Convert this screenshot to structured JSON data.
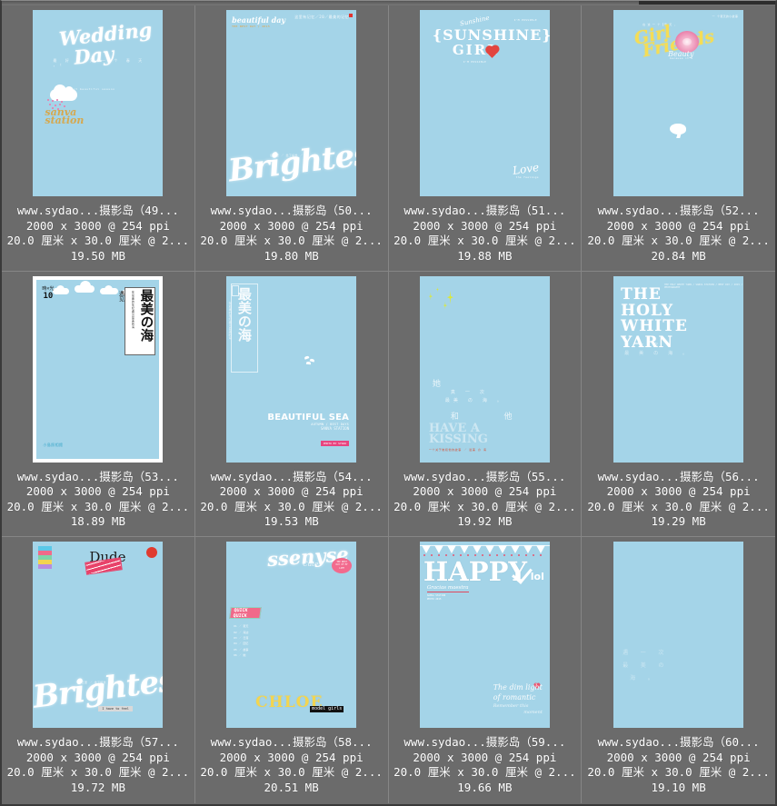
{
  "app": {
    "window_title": "Image Browser Grid",
    "background_color": "#6b6b6b",
    "thumbnail_color": "#a4d4e8",
    "grid_columns": 4,
    "grid_rows": 3
  },
  "items": [
    {
      "filename": "www.sydao...摄影岛（49...",
      "dimensions": "2000 x 3000 @ 254 ppi",
      "physical": "20.0 厘米 x 30.0 厘米 @ 2...",
      "filesize": "19.50 MB",
      "art": {
        "title": "Wedding",
        "title2": "Day",
        "subtitle": "最 好 了 又 一 个 春 天 ，！",
        "brand": "sanva",
        "brand2": "station",
        "brandline": "the most beautiful season"
      }
    },
    {
      "filename": "www.sydao...摄影岛（50...",
      "dimensions": "2000 x 3000 @ 254 ppi",
      "physical": "20.0 厘米 x 30.0 厘米 @ 2...",
      "filesize": "19.80 MB",
      "art": {
        "head": "beautiful day",
        "head_sub": "THE BEST DAY / 2015",
        "topright": "这里有记忆／20／最美的记忆",
        "main": "Brightest",
        "main_sub": "记忆里 ／ 念了好长 ／ 一 ．"
      }
    },
    {
      "filename": "www.sydao...摄影岛（51...",
      "dimensions": "2000 x 3000 @ 254 ppi",
      "physical": "20.0 厘米 x 30.0 厘米 @ 2...",
      "filesize": "19.88 MB",
      "art": {
        "script": "Sunshine",
        "brace": "{SUNSHINE}",
        "girl": "GIRL",
        "tagline": "I'M POSSIBLE",
        "love": "Love",
        "love_sub": "the feelings"
      }
    },
    {
      "filename": "www.sydao...摄影岛（52...",
      "dimensions": "2000 x 3000 @ 254 ppi",
      "physical": "20.0 厘米 x 30.0 厘米 @ 2...",
      "filesize": "20.84 MB",
      "art": {
        "title": "Girl",
        "title2": "Friends",
        "cn_top": "在  这  一  个 ┃夏 天 ，",
        "topright": "一 个夏天的小故事",
        "sig": "because it's",
        "sig2": "Beauty"
      }
    },
    {
      "filename": "www.sydao...摄影岛（53...",
      "dimensions": "2000 x 3000 @ 254 ppi",
      "physical": "20.0 厘米 x 30.0 厘米 @ 2...",
      "filesize": "18.89 MB",
      "art": {
        "title": "最美の海",
        "author": "遇见",
        "side": "在最美的年纪遇见最美的海",
        "left_label": "時×光",
        "left_num": "10",
        "foot": "小島照相館"
      }
    },
    {
      "filename": "www.sydao...摄影岛（54...",
      "dimensions": "2000 x 3000 @ 254 ppi",
      "physical": "20.0 厘米 x 30.0 厘米 @ 2...",
      "filesize": "19.53 MB",
      "art": {
        "title": "最美の海",
        "side": "在最美的年纪遇见最美的海",
        "tag": "最 美",
        "en": "BEAUTIFUL SEA",
        "en_sub": "AUTUMN / BEST DAYS",
        "en_sub2": "SANVA STATION",
        "pink": "PHOTO BY SYDAO"
      }
    },
    {
      "filename": "www.sydao...摄影岛（55...",
      "dimensions": "2000 x 3000 @ 254 ppi",
      "physical": "20.0 厘米 x 30.0 厘米 @ 2...",
      "filesize": "19.92 MB",
      "art": {
        "cn1": "她",
        "cn2": "真 一 次",
        "cn3": "最美 の 海 。",
        "cn4": "和",
        "cn5": "他",
        "en1": "HAVE A",
        "en2": "KISSING",
        "red": "一个关于她和他的故事 ／ 最美 の 海"
      }
    },
    {
      "filename": "www.sydao...摄影岛（56...",
      "dimensions": "2000 x 3000 @ 254 ppi",
      "physical": "20.0 厘米 x 30.0 厘米 @ 2...",
      "filesize": "19.29 MB",
      "art": {
        "l1": "THE",
        "l2": "HOLY",
        "l3": "WHITE",
        "l4": "YARN",
        "cn1": "遇 一 次",
        "cn2": "最 美 の 海 。",
        "side": "THE HOLY WHITE YARN / SANVA STATION / BEST DAY / 2015 / PHOTOGRAPHY"
      }
    },
    {
      "filename": "www.sydao...摄影岛（57...",
      "dimensions": "2000 x 3000 @ 254 ppi",
      "physical": "20.0 厘米 x 30.0 厘米 @ 2...",
      "filesize": "19.72 MB",
      "art": {
        "title": "Dude",
        "main": "Brightest",
        "main_sub": "记忆里 ／ 念了好长 ／ 一 ．",
        "foot": "I have to feel"
      }
    },
    {
      "filename": "www.sydao...摄影岛（58...",
      "dimensions": "2000 x 3000 @ 254 ppi",
      "physical": "20.0 厘米 x 30.0 厘米 @ 2...",
      "filesize": "20.51 MB",
      "art": {
        "title": "ssenyse",
        "sub": "Cute",
        "badge": "THE BEST DAY OF MY LIFE",
        "quick": "QUICK QUICK",
        "list": "01 ／ 夏天\n02 ／ 海边\n03 ／ 日落\n04 ／ 回忆\n05 ／ 故事\n06 ／ 她",
        "name": "CHLOE",
        "name_blk": "model girls"
      }
    },
    {
      "filename": "www.sydao...摄影岛（59...",
      "dimensions": "2000 x 3000 @ 254 ppi",
      "physical": "20.0 厘米 x 30.0 厘米 @ 2...",
      "filesize": "19.66 MB",
      "art": {
        "title": "HAPPY",
        "lol": "lol",
        "sub": "Gracias maestra",
        "badge": "SANVA STATION\nPHOTO 2015",
        "quote1": "The dim light",
        "quote2": "of romantic",
        "quote3": "Remember this",
        "quote4": "moment"
      }
    },
    {
      "filename": "www.sydao...摄影岛（60...",
      "dimensions": "2000 x 3000 @ 254 ppi",
      "physical": "20.0 厘米 x 30.0 厘米 @ 2...",
      "filesize": "19.10 MB",
      "art": {
        "cn1": "遇  一  次",
        "cn2": "最  美  の",
        "cn3": "海  。"
      }
    }
  ]
}
